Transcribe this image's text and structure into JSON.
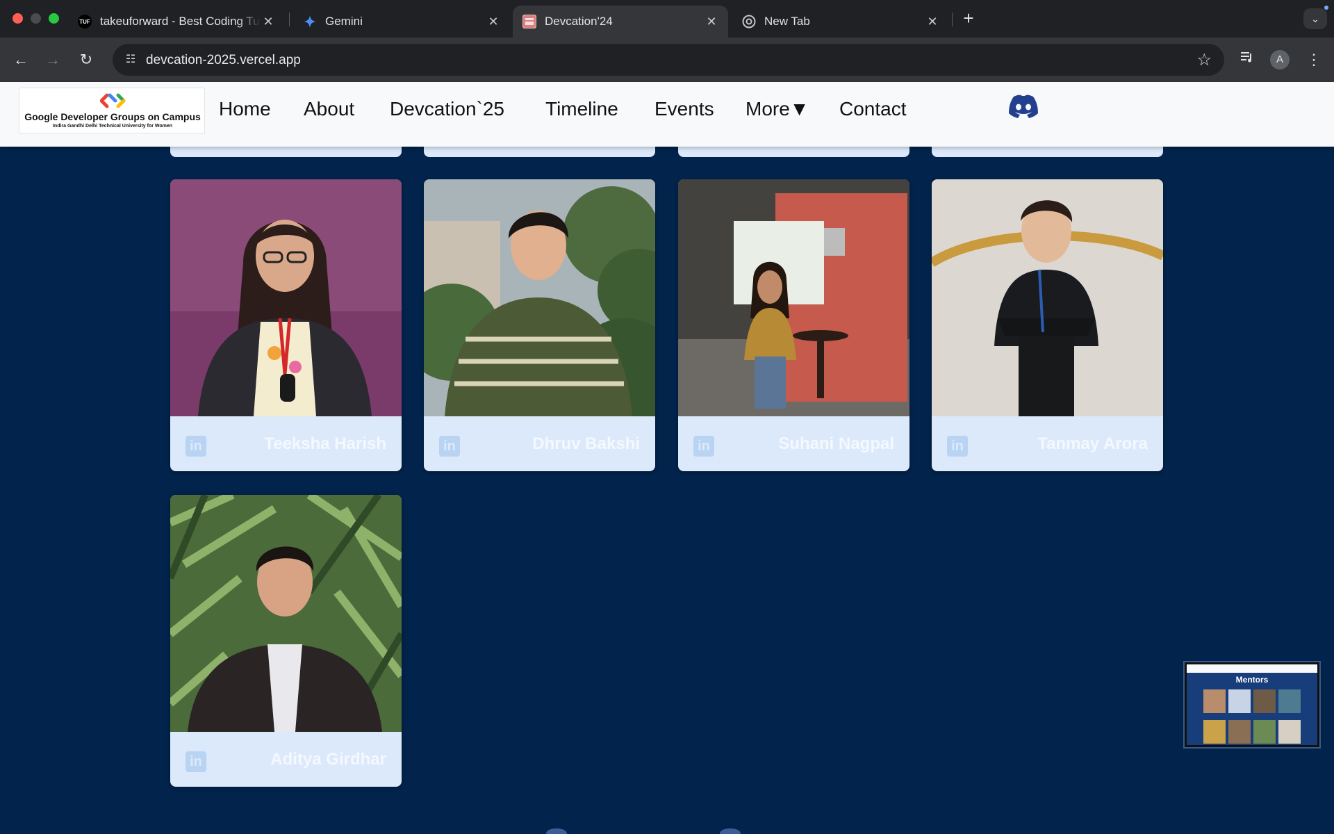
{
  "browser": {
    "tabs": [
      {
        "title": "takeuforward - Best Coding Tutorials",
        "favicon": "tuf-icon"
      },
      {
        "title": "Gemini",
        "favicon": "gemini-icon"
      },
      {
        "title": "Devcation'24",
        "favicon": "devcation-icon",
        "active": true
      },
      {
        "title": "New Tab",
        "favicon": "chrome-icon"
      }
    ],
    "tufFaviconText": "TUF",
    "url": "devcation-2025.vercel.app",
    "profileInitial": "A"
  },
  "site": {
    "logo": {
      "title": "Google Developer Groups on Campus",
      "subtitle": "Indira Gandhi Delhi Technical University for Women"
    },
    "nav": [
      "Home",
      "About",
      "Devcation`25",
      "Timeline",
      "Events",
      "More▼",
      "Contact"
    ]
  },
  "mentors": [
    {
      "name": "Teeksha Harish"
    },
    {
      "name": "Dhruv Bakshi"
    },
    {
      "name": "Suhani Nagpal"
    },
    {
      "name": "Tanmay Arora"
    },
    {
      "name": "Aditya Girdhar"
    }
  ],
  "pip": {
    "title": "Mentors"
  },
  "colors": {
    "pageBg": "#02234b",
    "card": "#dce9fb",
    "navBg": "#f8f9fb",
    "discord": "#23408e"
  }
}
